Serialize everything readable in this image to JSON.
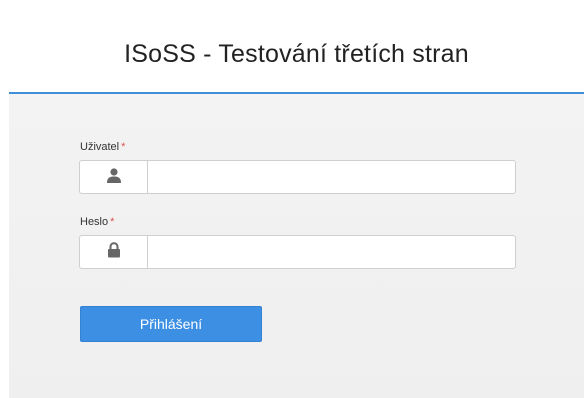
{
  "header": {
    "title": "ISoSS - Testování třetích stran"
  },
  "form": {
    "user": {
      "label": "Uživatel",
      "required_mark": "*",
      "icon": "user-icon",
      "value": "",
      "placeholder": ""
    },
    "password": {
      "label": "Heslo",
      "required_mark": "*",
      "icon": "lock-icon",
      "value": "",
      "placeholder": ""
    },
    "submit_label": "Přihlášení"
  },
  "colors": {
    "accent": "#3d8fe3",
    "header_border": "#3e8fd8",
    "required": "#d9534f",
    "panel_bg": "#f2f2f2"
  }
}
